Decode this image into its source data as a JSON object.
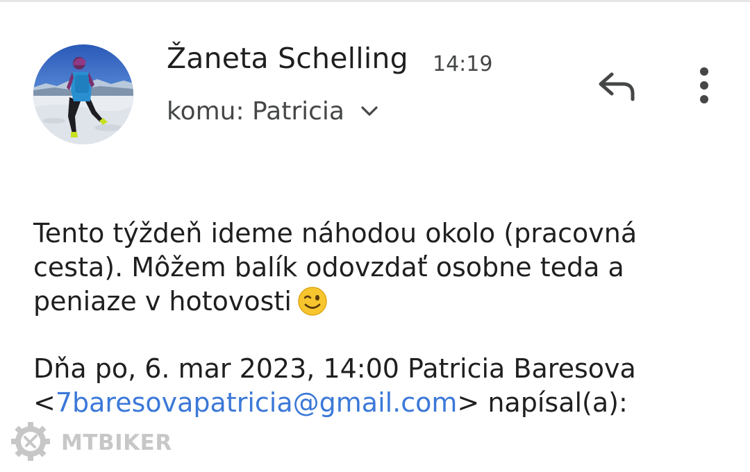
{
  "email": {
    "sender_name": "Žaneta Schelling",
    "time": "14:19",
    "recipient": "komu: Patricia"
  },
  "icons": {
    "avatar": "avatar-photo",
    "recipient_expand": "chevron-down-icon",
    "reply": "reply-icon",
    "more": "more-vert-icon",
    "emoji": "winking-face-emoji"
  },
  "body": {
    "line1": "Tento týždeň ideme náhodou okolo (pracovná",
    "line2": "cesta). Môžem balík odovzdať osobne teda a",
    "line3": "peniaze v hotovosti"
  },
  "quote": {
    "header": "Dňa po, 6. mar 2023, 14:00 Patricia Baresova",
    "open_bracket": "<",
    "email": "7baresovapatricia@gmail.com",
    "suffix": "> napísal(a):"
  },
  "watermark": {
    "text": "MTBIKER"
  },
  "colors": {
    "link": "#3b78d8",
    "text_primary": "#1f1f1f",
    "text_secondary": "#444746",
    "icon": "#444746"
  }
}
